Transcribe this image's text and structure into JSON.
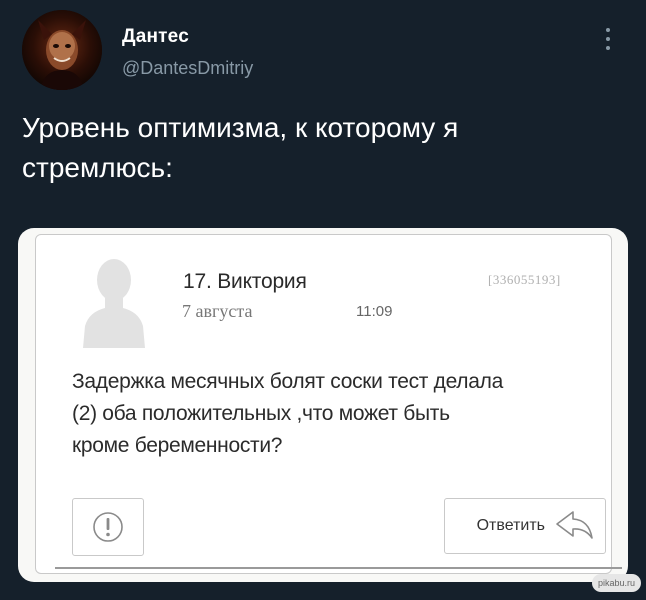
{
  "author": {
    "name": "Дантес",
    "handle": "@DantesDmitriy",
    "avatar_icon": "devil-portrait-avatar"
  },
  "tweet": {
    "text_line1": "Уровень оптимизма, к которому я",
    "text_line2": "стремлюсь:"
  },
  "media": {
    "message_title": "17. Виктория",
    "message_date": "7 августа",
    "message_time": "11:09",
    "message_id": "[336055193]",
    "body_line1": "Задержка месячных болят соски тест делала",
    "body_line2": "(2) оба положительных ,что может быть",
    "body_line3": "кроме беременности?",
    "reply_label": "Ответить",
    "warning_icon": "exclamation-circle-icon",
    "reply_icon": "reply-arrow-icon"
  },
  "watermark": "pikabu.ru",
  "colors": {
    "background": "#15202b",
    "text_primary": "#ffffff",
    "text_secondary": "#8899a6",
    "card_background": "#ffffff"
  }
}
